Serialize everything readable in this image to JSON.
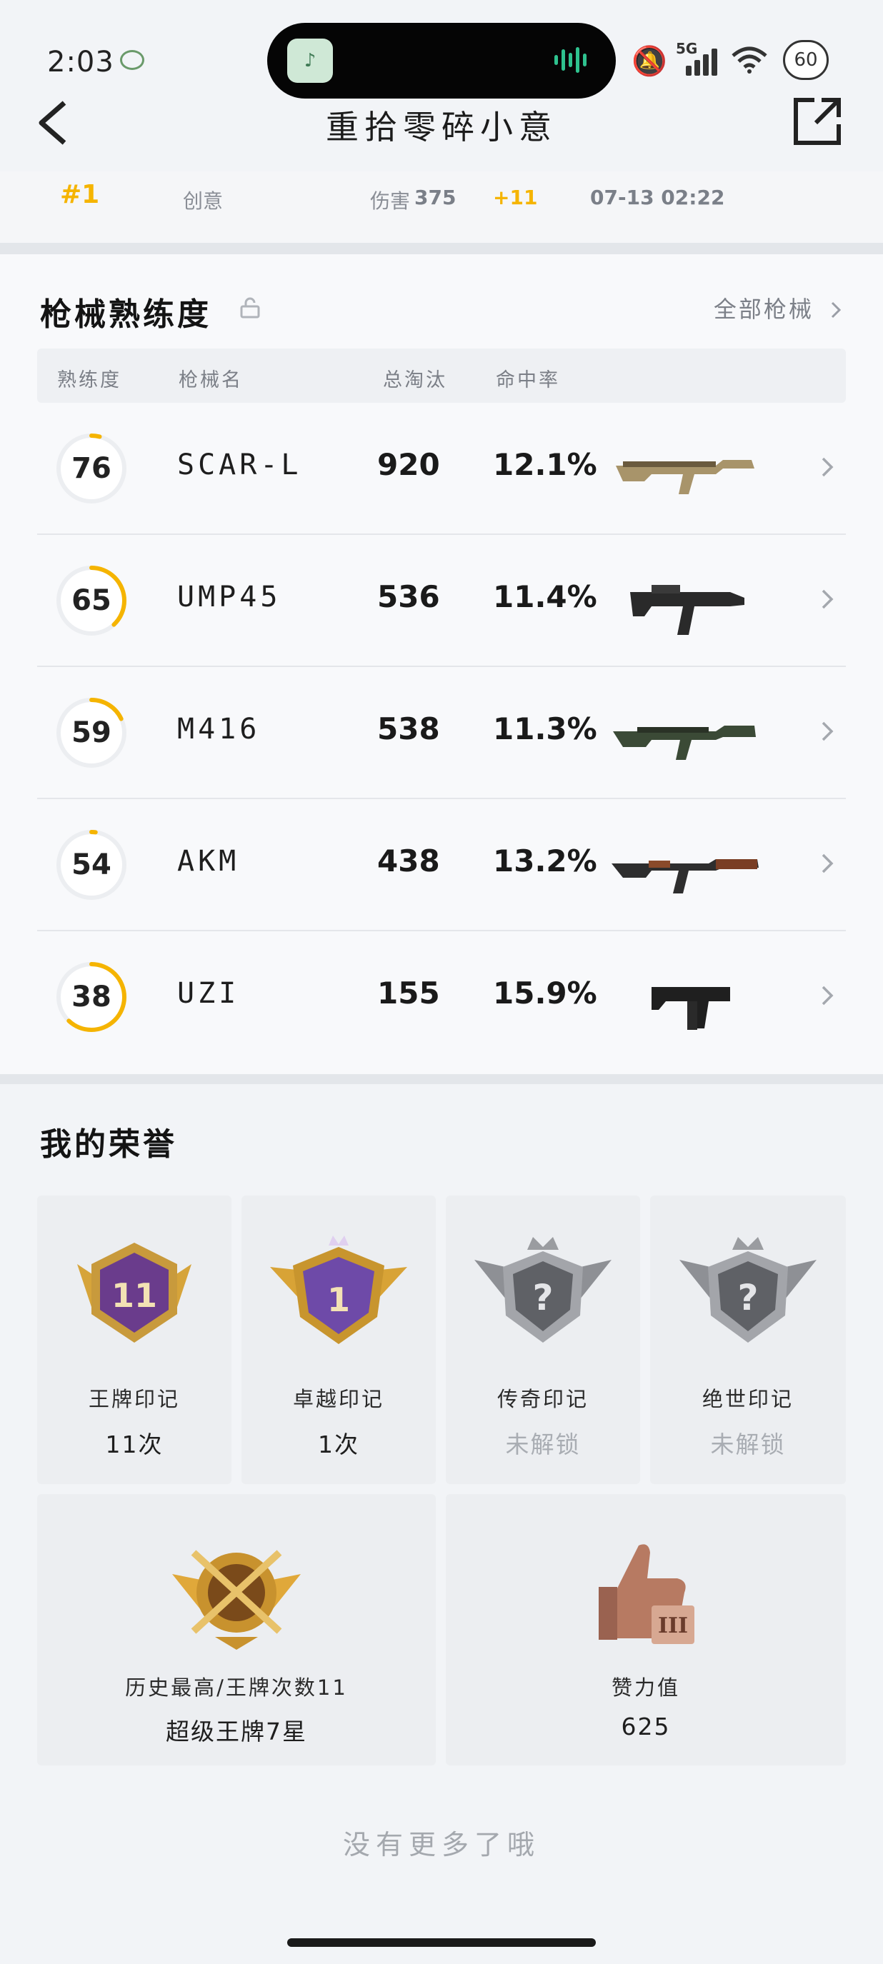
{
  "status_bar": {
    "time": "2:03",
    "network": "5G",
    "battery": "60"
  },
  "nav": {
    "title": "重拾零碎小意"
  },
  "match_strip": {
    "rank": "#1",
    "mode": "创意",
    "damage_label": "伤害",
    "damage_value": "375",
    "kills": "+11",
    "time": "07-13 02:22"
  },
  "weapons": {
    "title": "枪械熟练度",
    "all_link": "全部枪械",
    "headers": {
      "mastery": "熟练度",
      "name": "枪械名",
      "kills": "总淘汰",
      "rate": "命中率"
    },
    "rows": [
      {
        "mastery": "76",
        "progress": 0.04,
        "name": "SCAR-L",
        "kills": "920",
        "rate": "12.1%",
        "icon": "assault-rifle-tan"
      },
      {
        "mastery": "65",
        "progress": 0.38,
        "name": "UMP45",
        "kills": "536",
        "rate": "11.4%",
        "icon": "smg-black"
      },
      {
        "mastery": "59",
        "progress": 0.18,
        "name": "M416",
        "kills": "538",
        "rate": "11.3%",
        "icon": "assault-rifle-green"
      },
      {
        "mastery": "54",
        "progress": 0.02,
        "name": "AKM",
        "kills": "438",
        "rate": "13.2%",
        "icon": "assault-rifle-wood"
      },
      {
        "mastery": "38",
        "progress": 0.62,
        "name": "UZI",
        "kills": "155",
        "rate": "15.9%",
        "icon": "micro-smg-black"
      }
    ]
  },
  "honors": {
    "title": "我的荣誉",
    "tiles": [
      {
        "name": "王牌印记",
        "value": "11次",
        "emblem_text": "11",
        "locked": false
      },
      {
        "name": "卓越印记",
        "value": "1次",
        "emblem_text": "1",
        "locked": false
      },
      {
        "name": "传奇印记",
        "value": "未解锁",
        "emblem_text": "?",
        "locked": true
      },
      {
        "name": "绝世印记",
        "value": "未解锁",
        "emblem_text": "?",
        "locked": true
      }
    ],
    "wide": [
      {
        "name": "历史最高/王牌次数11",
        "value": "超级王牌7星",
        "icon": "crossed-guns-emblem"
      },
      {
        "name": "赞力值",
        "value": "625",
        "emblem_text": "III",
        "icon": "thumbs-up-emblem"
      }
    ]
  },
  "footer": "没有更多了哦",
  "colors": {
    "accent": "#f5b400",
    "ring_track": "#eceef1",
    "background": "#f2f4f7"
  }
}
